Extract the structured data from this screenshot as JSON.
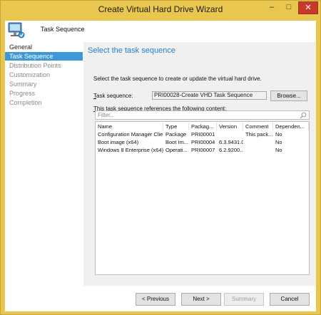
{
  "window": {
    "title": "Create Virtual Hard Drive Wizard",
    "controls": {
      "minimize": "–",
      "maximize": "□",
      "close": "✕"
    }
  },
  "header": {
    "title": "Task Sequence",
    "icon": "computer-wizard-icon"
  },
  "nav": {
    "items": [
      {
        "label": "General",
        "state": "done"
      },
      {
        "label": "Task Sequence",
        "state": "active"
      },
      {
        "label": "Distribution Points",
        "state": "pending"
      },
      {
        "label": "Customization",
        "state": "pending"
      },
      {
        "label": "Summary",
        "state": "pending"
      },
      {
        "label": "Progress",
        "state": "pending"
      },
      {
        "label": "Completion",
        "state": "pending"
      }
    ]
  },
  "content": {
    "page_title": "Select the task sequence",
    "instruction": "Select the task sequence to create or update the virtual hard drive.",
    "task_sequence_label_key": "T",
    "task_sequence_label_rest": "ask sequence:",
    "task_sequence_value": "PRI00028-Create VHD Task Sequence",
    "browse_label": "Browse...",
    "references_label_key": "T",
    "references_label_rest": "his task sequence references the following content:",
    "filter_placeholder": "Filter...",
    "columns": [
      "Name",
      "Type",
      "Packag...",
      "Version",
      "Comment",
      "Dependen..."
    ],
    "rows": [
      [
        "Configuration Manager Clie...",
        "Package",
        "PRI00001",
        "",
        "This pack...",
        "No"
      ],
      [
        "Boot image (x64)",
        "Boot Im...",
        "PRI00004",
        "6.3.9431.0",
        "",
        "No"
      ],
      [
        "Windows 8 Enterprise (x64)",
        "Operati...",
        "PRI00007",
        "6.2.9200....",
        "",
        "No"
      ]
    ]
  },
  "footer": {
    "previous_label": "< Previous",
    "next_label": "Next >",
    "summary_label": "Summary",
    "cancel_label": "Cancel"
  },
  "colors": {
    "accent": "#2a7ec1",
    "nav_active": "#3d98d8",
    "window_frame": "#e9c64e",
    "close_button": "#c7392b"
  }
}
